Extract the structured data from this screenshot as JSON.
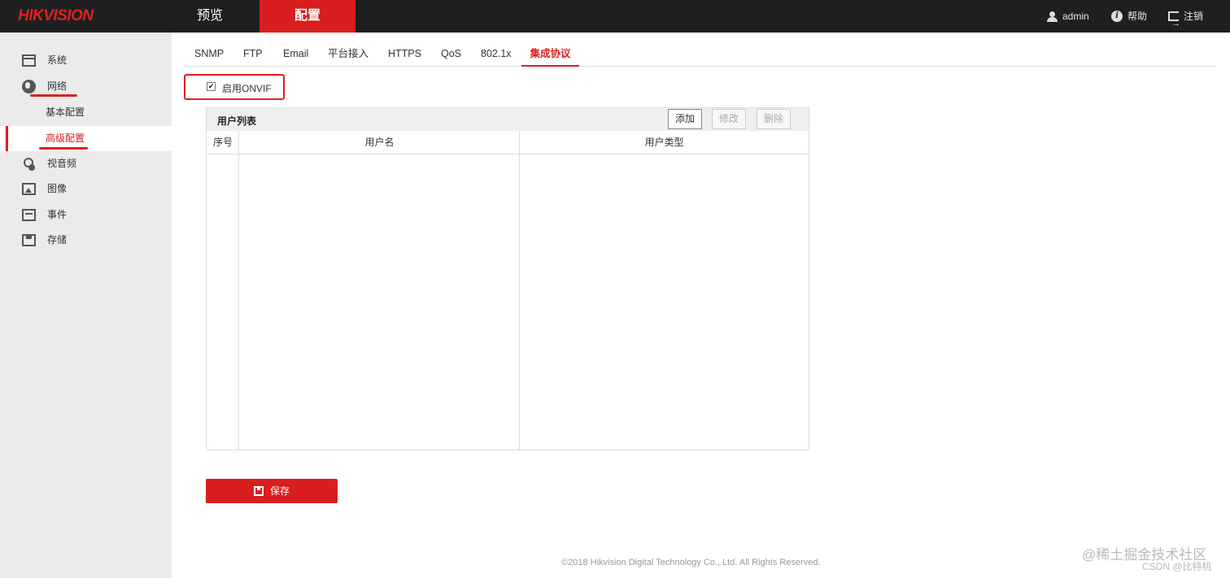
{
  "topbar": {
    "logo_hik": "HIK",
    "logo_vision": "VISION",
    "nav": [
      {
        "label": "预览"
      },
      {
        "label": "配置"
      }
    ],
    "user": "admin",
    "help": "帮助",
    "logout": "注销"
  },
  "sidebar": {
    "items": [
      {
        "label": "系统"
      },
      {
        "label": "网络"
      },
      {
        "label": "基本配置"
      },
      {
        "label": "高级配置"
      },
      {
        "label": "视音频"
      },
      {
        "label": "图像"
      },
      {
        "label": "事件"
      },
      {
        "label": "存储"
      }
    ]
  },
  "tabs": [
    {
      "label": "SNMP"
    },
    {
      "label": "FTP"
    },
    {
      "label": "Email"
    },
    {
      "label": "平台接入"
    },
    {
      "label": "HTTPS"
    },
    {
      "label": "QoS"
    },
    {
      "label": "802.1x"
    },
    {
      "label": "集成协议"
    }
  ],
  "onvif": {
    "label": "启用ONVIF",
    "checked_mark": "✔"
  },
  "user_list": {
    "title": "用户列表",
    "add": "添加",
    "edit": "修改",
    "delete": "删除",
    "columns": [
      "序号",
      "用户名",
      "用户类型"
    ]
  },
  "save_label": "保存",
  "footer": "©2018 Hikvision Digital Technology Co., Ltd. All Rights Reserved.",
  "watermark": {
    "line1": "@稀土掘金技术社区",
    "line2": "CSDN @比特桃"
  },
  "colors": {
    "accent": "#d81e1e",
    "topbar": "#1f1f1f",
    "sidebar": "#ebebeb"
  }
}
